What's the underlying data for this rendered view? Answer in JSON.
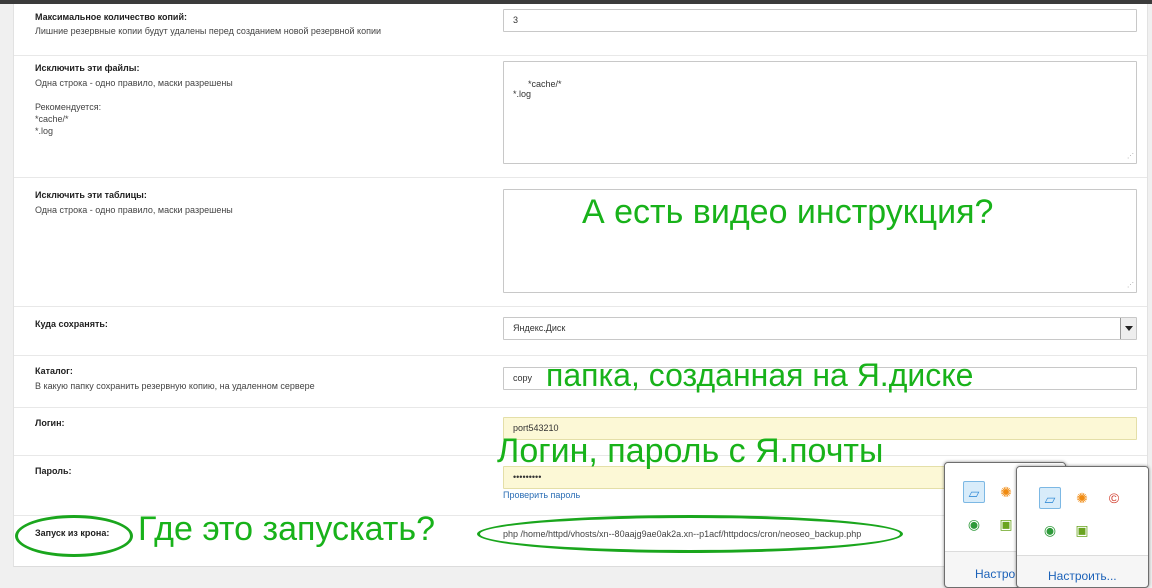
{
  "form": {
    "max_copies": {
      "label": "Максимальное количество копий:",
      "hint": "Лишние резервные копии будут удалены перед созданием новой резервной копии",
      "value": "3"
    },
    "exclude_files": {
      "label": "Исключить эти файлы:",
      "hint": "Одна строка - одно правило, маски разрешены\n\nРекомендуется:\n*cache/*\n*.log",
      "value": "*cache/*\n*.log"
    },
    "exclude_tables": {
      "label": "Исключить эти таблицы:",
      "hint": "Одна строка - одно правило, маски разрешены",
      "value": ""
    },
    "save_to": {
      "label": "Куда сохранять:",
      "selected": "Яндекс.Диск"
    },
    "catalog": {
      "label": "Каталог:",
      "hint": "В какую папку сохранить резервную копию, на удаленном сервере",
      "value": "copy"
    },
    "login": {
      "label": "Логин:",
      "value": "port543210"
    },
    "password": {
      "label": "Пароль:",
      "value": "•••••••••",
      "check_link": "Проверить пароль"
    },
    "cron": {
      "label": "Запуск из крона:",
      "command": "php /home/httpd/vhosts/xn--80aajg9ae0ak2a.xn--p1acf/httpdocs/cron/neoseo_backup.php"
    }
  },
  "annotations": {
    "video_question": "А есть видео инструкция?",
    "folder_note": "папка, созданная на Я.диске",
    "login_note": "Логин, пароль с Я.почты",
    "where_run": "Где это запускать?"
  },
  "tray": {
    "customize_label_back": "Настро",
    "customize_label_front": "Настроить...",
    "icons": [
      "pc-icon",
      "avast-icon",
      "ccleaner-icon",
      "chrome-icon",
      "nvidia-icon"
    ]
  },
  "colors": {
    "annotation": "#18b21a",
    "link": "#2a6db5",
    "highlight_field": "#fcf8d6"
  }
}
